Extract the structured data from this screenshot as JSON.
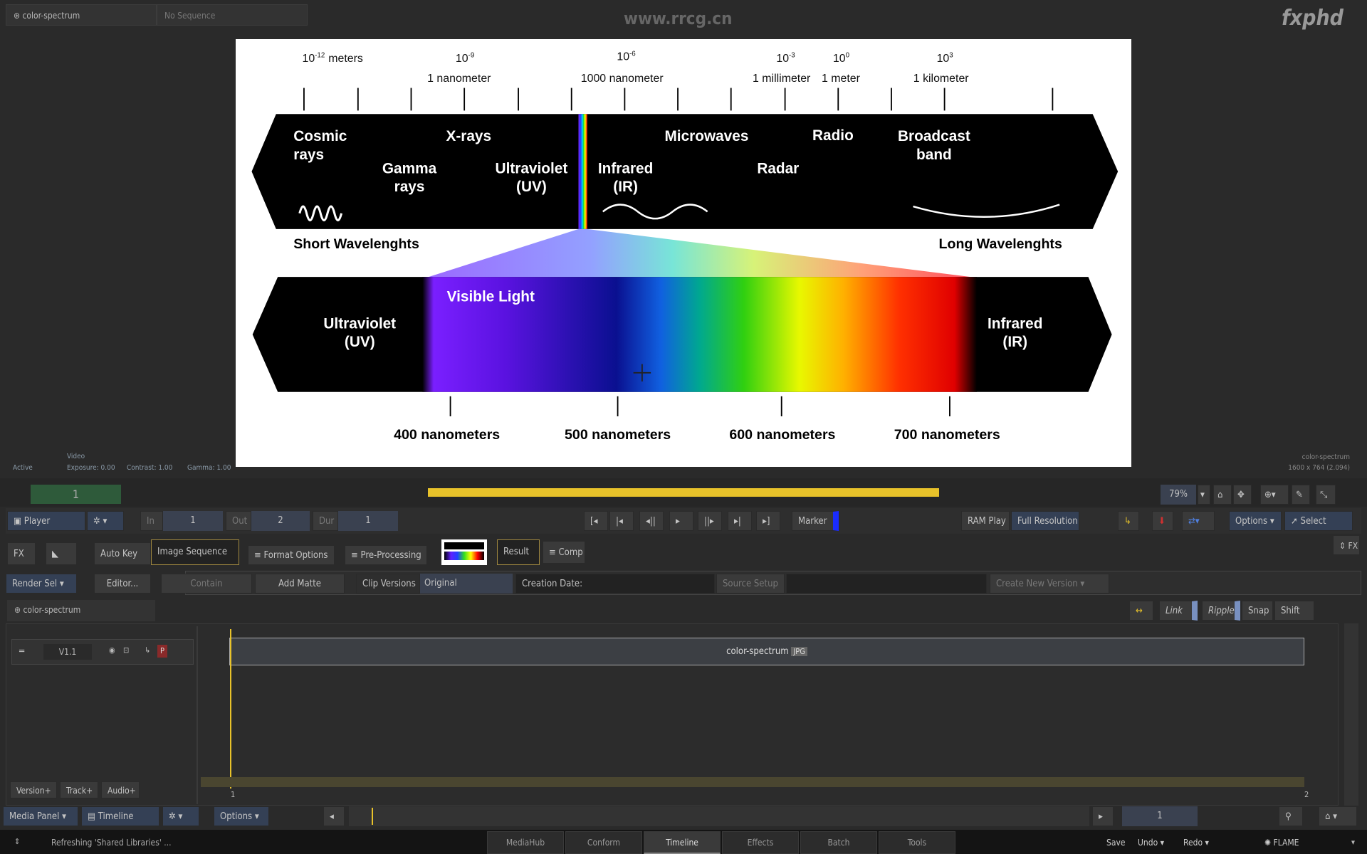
{
  "tabs": [
    {
      "label": "color-spectrum"
    },
    {
      "label": "No Sequence"
    }
  ],
  "watermark": {
    "site": "www.rrcg.cn",
    "brand": "fxphd"
  },
  "viewer": {
    "status": "Active",
    "channel": "Video",
    "exposure": "Exposure: 0.00",
    "contrast": "Contrast: 1.00",
    "gamma": "Gamma: 1.00",
    "clip_name": "color-spectrum",
    "resolution": "1600 x 764 (2.094)",
    "frame": "1",
    "zoom": "79%"
  },
  "spectrum": {
    "scale": [
      {
        "base": "10",
        "exp": "-12",
        "unit": "meters"
      },
      {
        "base": "10",
        "exp": "-9",
        "unit": "1 nanometer"
      },
      {
        "base": "10",
        "exp": "-6",
        "unit": "1000 nanometer"
      },
      {
        "base": "10",
        "exp": "-3",
        "unit": "1 millimeter"
      },
      {
        "base": "10",
        "exp": "0",
        "unit": "1 meter"
      },
      {
        "base": "10",
        "exp": "3",
        "unit": "1 kilometer"
      }
    ],
    "bands": {
      "cosmic1": "Cosmic",
      "cosmic2": "rays",
      "gamma1": "Gamma",
      "gamma2": "rays",
      "xrays": "X-rays",
      "uv1": "Ultraviolet",
      "uv2": "(UV)",
      "ir1": "Infrared",
      "ir2": "(IR)",
      "microwaves": "Microwaves",
      "radar": "Radar",
      "radio": "Radio",
      "broadcast1": "Broadcast",
      "broadcast2": "band"
    },
    "short": "Short Wavelenghts",
    "long": "Long Wavelenghts",
    "visible": "Visible Light",
    "uv1": "Ultraviolet",
    "uv2": "(UV)",
    "ir1": "Infrared",
    "ir2": "(IR)",
    "nm": [
      "400 nanometers",
      "500 nanometers",
      "600 nanometers",
      "700 nanometers"
    ]
  },
  "player": {
    "label": "Player",
    "in_label": "In",
    "in": "1",
    "out_label": "Out",
    "out": "2",
    "dur_label": "Dur",
    "dur": "1",
    "marker": "Marker",
    "ram_play": "RAM Play",
    "resolution": "Full Resolution",
    "options": "Options",
    "select": "Select"
  },
  "fxrow": {
    "fx": "FX",
    "auto_key": "Auto Key",
    "image_sequence": "Image Sequence",
    "format_options": "Format Options",
    "pre_processing": "Pre-Processing",
    "result": "Result",
    "comp": "Comp",
    "fx_toggle": "FX"
  },
  "renderrow": {
    "render_sel": "Render Sel",
    "editor": "Editor...",
    "contain": "Contain",
    "add_matte": "Add Matte",
    "clip_versions": "Clip Versions",
    "original": "Original",
    "creation_date": "Creation Date:",
    "source_setup": "Source Setup",
    "create_new_version": "Create New Version"
  },
  "timeline": {
    "tab": "color-spectrum",
    "link": "Link",
    "ripple": "Ripple",
    "snap": "Snap",
    "shift": "Shift",
    "track": "V1.1",
    "patch": "P",
    "clip": "color-spectrum",
    "clip_badge": "JPG",
    "ruler_start": "1",
    "ruler_end": "2",
    "version_add": "Version+",
    "track_add": "Track+",
    "audio_add": "Audio+"
  },
  "bottom": {
    "media_panel": "Media Panel",
    "timeline": "Timeline",
    "options": "Options",
    "frame": "1"
  },
  "status": {
    "message": "Refreshing 'Shared Libraries' ...",
    "nav": [
      "MediaHub",
      "Conform",
      "Timeline",
      "Effects",
      "Batch",
      "Tools"
    ],
    "active_nav": "Timeline",
    "save": "Save",
    "undo": "Undo",
    "redo": "Redo",
    "app": "FLAME"
  },
  "colors": {
    "accent": "#e8c22a",
    "marker": "#1a2cff",
    "frame_box": "#2e5a3a"
  }
}
